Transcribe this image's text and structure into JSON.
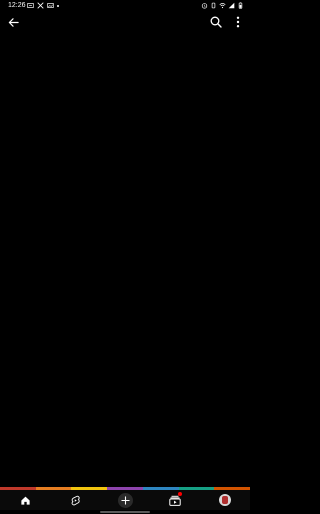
{
  "status_bar": {
    "time": "12:26",
    "left_icons": [
      "notification-icon",
      "crossed-icon",
      "image-icon",
      "dot-icon"
    ],
    "right_icons": [
      "alarm-icon",
      "vibrate-icon",
      "wifi-icon",
      "signal-icon",
      "battery-icon"
    ]
  },
  "top_bar": {
    "back_icon": "arrow-left-icon",
    "search_icon": "search-icon",
    "more_icon": "more-vertical-icon"
  },
  "progress_strip": {
    "colors": [
      "#c0392b",
      "#e67e22",
      "#f1c40f",
      "#8e44ad",
      "#2e86c1",
      "#16a085",
      "#d35400"
    ]
  },
  "bottom_nav": {
    "items": [
      {
        "name": "home",
        "icon": "home-icon",
        "selected": true
      },
      {
        "name": "shorts",
        "icon": "shorts-icon",
        "selected": false
      },
      {
        "name": "create",
        "icon": "plus-icon",
        "selected": false
      },
      {
        "name": "subscriptions",
        "icon": "subscriptions-icon",
        "selected": false,
        "badge": true
      },
      {
        "name": "you",
        "icon": "avatar-icon",
        "selected": false
      }
    ],
    "badge_color": "#ff0000"
  }
}
